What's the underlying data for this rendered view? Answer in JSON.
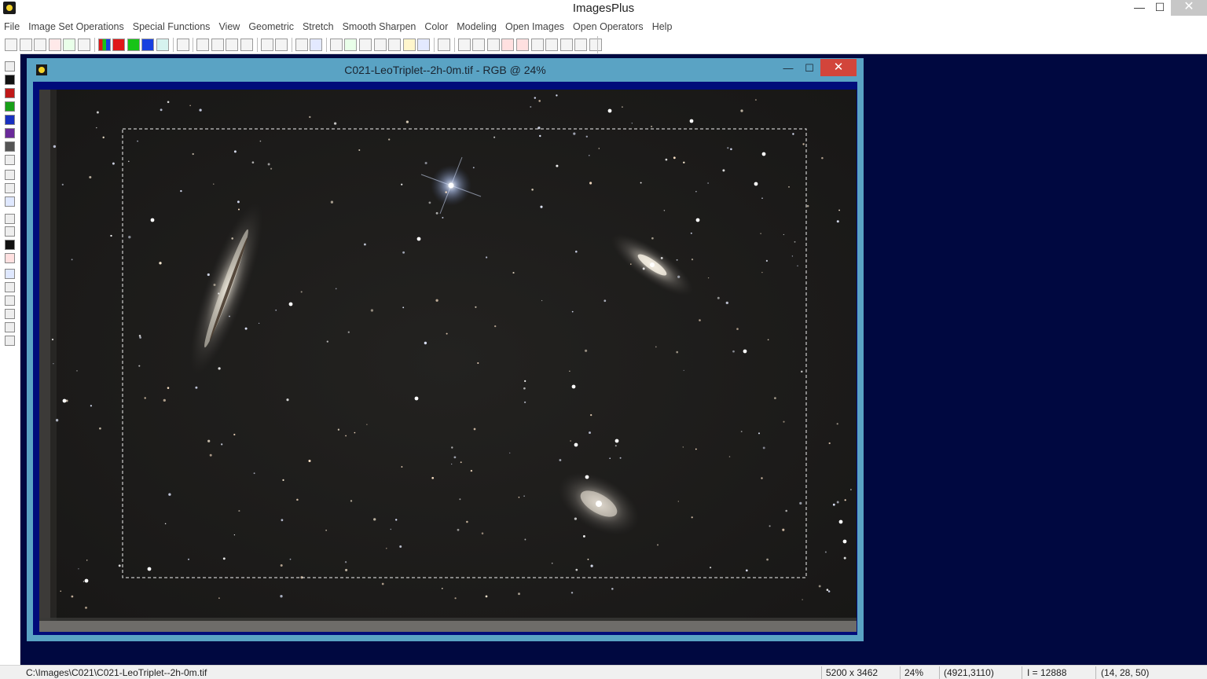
{
  "app": {
    "title": "ImagesPlus"
  },
  "window_controls": {
    "minimize": "—",
    "maximize": "☐",
    "close": "✕"
  },
  "menu": [
    "File",
    "Image Set Operations",
    "Special Functions",
    "View",
    "Geometric",
    "Stretch",
    "Smooth Sharpen",
    "Color",
    "Modeling",
    "Open Images",
    "Open Operators",
    "Help"
  ],
  "toolbar_icons": [
    "new-file-icon",
    "open-folder-icon",
    "save-icon",
    "close-red-x-icon",
    "close-green-x-icon",
    "print-icon",
    "rgb-channels-icon",
    "red-channel-icon",
    "green-channel-icon",
    "blue-channel-icon",
    "image-info-icon",
    "undo-icon",
    "redo-disabled-icon",
    "undo-red-icon",
    "redo-red-icon",
    "circle-select-icon",
    "circle-select-red-icon",
    "dotted-line-icon",
    "scatter-icon",
    "histogram-icon",
    "curves-icon",
    "add-plus-icon",
    "crosshair-icon",
    "grid-icon",
    "picture-icon",
    "pencil-icon",
    "table-icon",
    "zoom-icon",
    "zoom-out-icon",
    "zoom-in-icon",
    "zoom-fit-icon",
    "zoom-plus-icon",
    "zoom-minus-icon",
    "frame-icon",
    "frame-icon-2",
    "frame-icon-3",
    "frame-icon-4",
    "frame-small-icon"
  ],
  "left_tools": [
    "save-icon",
    "black-icon",
    "red-black-icon",
    "green-black-icon",
    "blue-black-icon",
    "red-blue-icon",
    "gray-black-icon",
    "white-black-icon",
    "gamma-icon",
    "gradient-icon",
    "star-icon",
    "crop-icon",
    "columns-icon",
    "black-bar-icon",
    "select-r-icon",
    "move-icon",
    "up-arrow-icon",
    "right-arrow-icon",
    "rotate-left-icon",
    "rotate-right-icon",
    "copy-icon"
  ],
  "image_window": {
    "title": "C021-LeoTriplet--2h-0m.tif - RGB @ 24%",
    "minimize": "—",
    "maximize": "☐",
    "close": "✕"
  },
  "statusbar": {
    "path": "C:\\Images\\C021\\C021-LeoTriplet--2h-0m.tif",
    "dimensions": "5200 x 3462",
    "zoom": "24%",
    "cursor": "(4921,3110)",
    "intensity": "I = 12888",
    "rgb": "(14, 28, 50)"
  },
  "colors": {
    "workspace": "#000840",
    "child_frame": "#5aa3c4",
    "child_close": "#d2453b"
  }
}
